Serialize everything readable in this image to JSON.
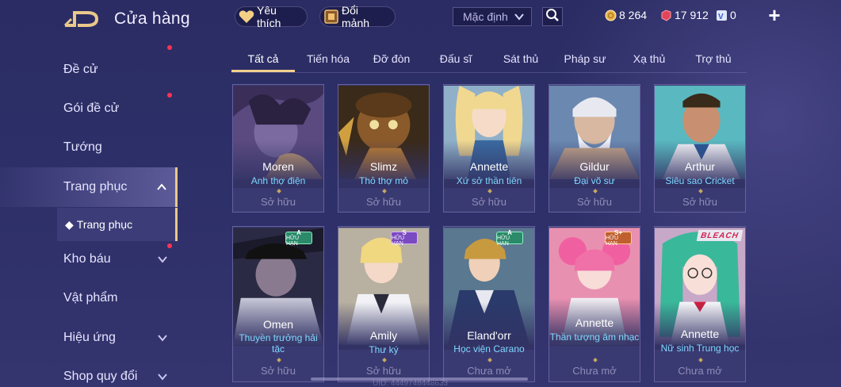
{
  "header": {
    "title": "Cửa hàng",
    "favorites_label": "Yêu thích",
    "exchange_label": "Đổi mảnh",
    "sort_value": "Mặc định",
    "currencies": [
      {
        "name": "gold",
        "value": "8 264"
      },
      {
        "name": "red-gem",
        "value": "17 912"
      },
      {
        "name": "voucher",
        "value": "0"
      }
    ],
    "plus_symbol": "+"
  },
  "sidebar": {
    "items": [
      {
        "label": "Đề cử"
      },
      {
        "label": "Gói đề cử",
        "dot": true
      },
      {
        "label": "Tướng"
      },
      {
        "label": "Trang phục",
        "active": true
      },
      {
        "label": "Kho báu",
        "dot": true
      },
      {
        "label": "Vật phẩm"
      },
      {
        "label": "Hiệu ứng"
      },
      {
        "label": "Shop quy đổi"
      }
    ],
    "sub_item": "Trang phục"
  },
  "tabs": [
    "Tất cả",
    "Tiến hóa",
    "Đỡ đòn",
    "Đấu sĩ",
    "Sát thủ",
    "Pháp sư",
    "Xạ thủ",
    "Trợ thủ"
  ],
  "cards_row1": [
    {
      "hero": "Moren",
      "skin": "Anh thợ điện",
      "status": "Sở hữu"
    },
    {
      "hero": "Slimz",
      "skin": "Thỏ thợ mỏ",
      "status": "Sở hữu"
    },
    {
      "hero": "Annette",
      "skin": "Xứ sở thần tiên",
      "status": "Sở hữu"
    },
    {
      "hero": "Gildur",
      "skin": "Đại võ sư",
      "status": "Sở hữu"
    },
    {
      "hero": "Arthur",
      "skin": "Siêu sao Cricket",
      "status": "Sở hữu"
    }
  ],
  "cards_row2": [
    {
      "hero": "Omen",
      "skin": "Thuyền trưởng hải tặc",
      "status": "Sở hữu",
      "badge": "A",
      "badge_sub": "HỮU HẠN"
    },
    {
      "hero": "Amily",
      "skin": "Thư ký",
      "status": "Sở hữu",
      "badge": "S",
      "badge_sub": "HỮU HẠN"
    },
    {
      "hero": "Eland'orr",
      "skin": "Học viện Carano",
      "status": "Chưa mở",
      "badge": "A",
      "badge_sub": "HỮU HẠN"
    },
    {
      "hero": "Annette",
      "skin": "Thần tượng âm nhạc",
      "status": "Chưa mở",
      "badge": "S+",
      "badge_sub": "HỮU HẠN"
    },
    {
      "hero": "Annette",
      "skin": "Nữ sinh Trung học",
      "status": "Chưa mở",
      "logo": "BLEACH"
    }
  ],
  "footer": {
    "uid": "UID: 4449748448633"
  },
  "colors": {
    "accent_gold": "#f2d08e",
    "skin_name": "#7fd8ff",
    "notif_dot": "#ff3355"
  }
}
